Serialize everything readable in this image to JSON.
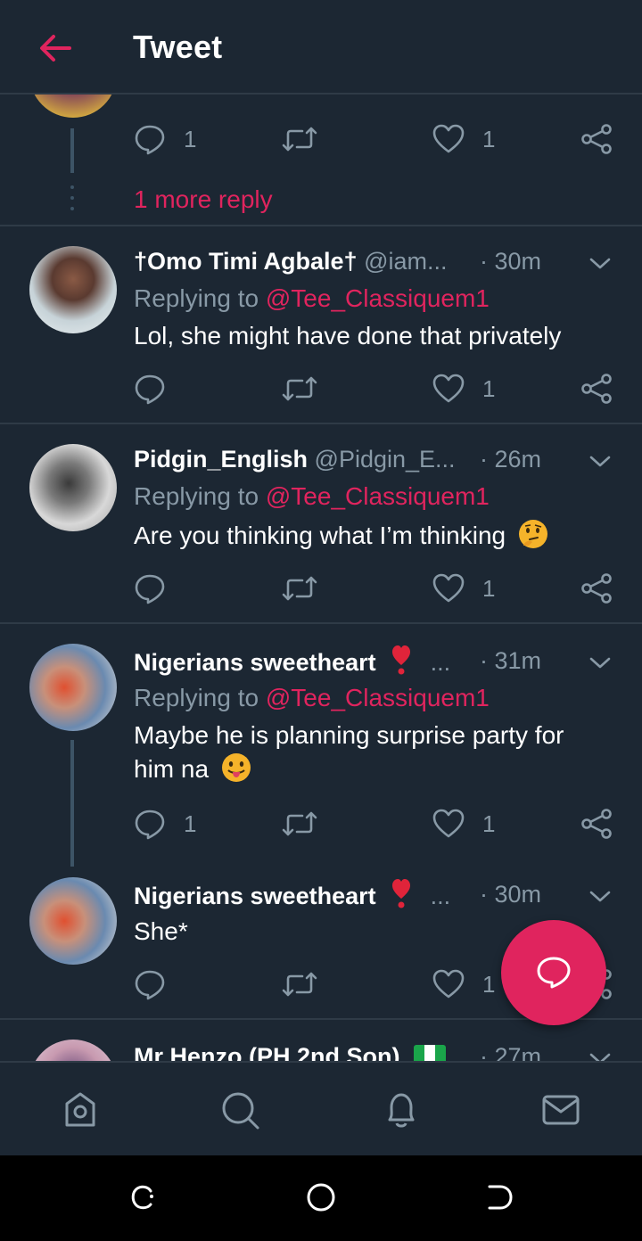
{
  "header": {
    "title": "Tweet",
    "back_icon": "arrow-left-icon"
  },
  "top_reply": {
    "reply_count": "1",
    "like_count": "1",
    "more_replies": "1 more reply"
  },
  "tweets": [
    {
      "name": "†Omo Timi Agbale†",
      "handle": "@iam...",
      "time": "· 30m",
      "replying_prefix": "Replying to ",
      "replying_to": "@Tee_Classiquem1",
      "text": "Lol, she might have done that privately",
      "reply_count": "",
      "like_count": "1"
    },
    {
      "name": "Pidgin_English",
      "handle": "@Pidgin_E...",
      "time": "· 26m",
      "replying_prefix": "Replying to ",
      "replying_to": "@Tee_Classiquem1",
      "text": "Are you thinking what I’m thinking",
      "emoji": "thinking-face-emoji",
      "reply_count": "",
      "like_count": "1"
    },
    {
      "name": "Nigerians sweetheart",
      "handle": "...",
      "time": "· 31m",
      "replying_prefix": "Replying to ",
      "replying_to": "@Tee_Classiquem1",
      "text_line1": "Maybe he is planning surprise party for",
      "text_line2": "him na",
      "emoji": "tongue-out-emoji",
      "reply_count": "1",
      "like_count": "1"
    },
    {
      "name": "Nigerians sweetheart",
      "handle": "...",
      "time": "· 30m",
      "text": "She*",
      "reply_count": "",
      "like_count": "1"
    },
    {
      "name": "Mr Henzo (PH 2nd Son)",
      "time": "· 27m"
    }
  ],
  "colors": {
    "background": "#1c2733",
    "accent": "#e0245e",
    "secondary_text": "#8899a6",
    "divider": "#2f3b47"
  },
  "bottom_nav": [
    "home-icon",
    "search-icon",
    "notifications-bell-icon",
    "messages-mail-icon"
  ],
  "fab": {
    "icon": "compose-reply-icon"
  }
}
